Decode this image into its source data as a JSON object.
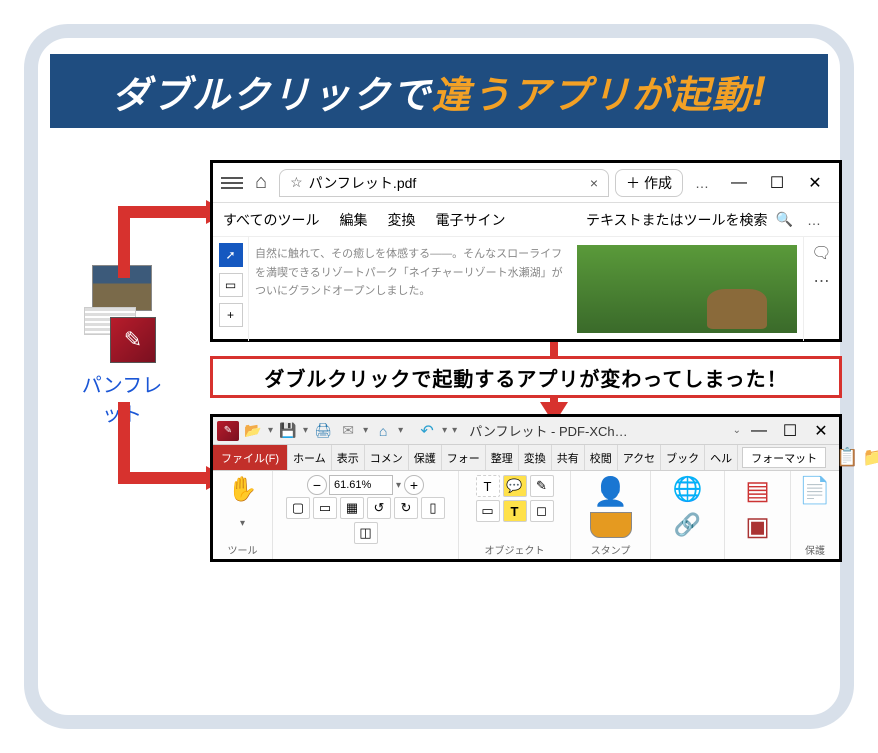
{
  "title": {
    "left": "ダブルクリックで",
    "mid": "違うアプリが起動",
    "mark": "!"
  },
  "fileIcon": {
    "label": "パンフレット"
  },
  "app1": {
    "tab": {
      "name": "パンフレット.pdf"
    },
    "newtab": "作成",
    "dots": "…",
    "menus": {
      "allTools": "すべてのツール",
      "edit": "編集",
      "convert": "変換",
      "esign": "電子サイン"
    },
    "search": "テキストまたはツールを検索",
    "docText": "自然に触れて、その癒しを体感する――。そんなスローライフを満喫できるリゾートパーク「ネイチャーリゾート水瀬湖」がついにグランドオープンしました。"
  },
  "caption": "ダブルクリックで起動するアプリが変わってしまった！",
  "app2": {
    "title": "パンフレット - PDF-XCh…",
    "tabs": {
      "file": "ファイル(F)",
      "home": "ホーム",
      "view": "表示",
      "comment": "コメン",
      "protect": "保護",
      "form": "フォー",
      "arrange": "整理",
      "convert": "変換",
      "share": "共有",
      "review": "校閲",
      "access": "アクセ",
      "bookmark": "ブック",
      "help": "ヘル",
      "format": "フォーマット"
    },
    "zoom": "61.61%",
    "groups": {
      "tool": "ツール",
      "object": "オブジェクト",
      "stamp": "スタンプ",
      "protect": "保護"
    },
    "iconText": {
      "textBox": "T",
      "highlight": "T"
    }
  }
}
